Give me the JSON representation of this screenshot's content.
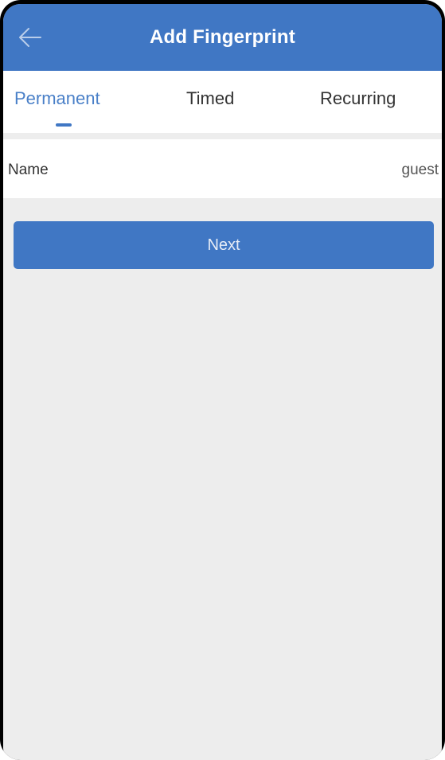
{
  "header": {
    "title": "Add Fingerprint",
    "back_icon": "arrow-left-icon",
    "background_color": "#4077c4"
  },
  "tabs": [
    {
      "label": "Permanent",
      "active": true
    },
    {
      "label": "Timed",
      "active": false
    },
    {
      "label": "Recurring",
      "active": false
    }
  ],
  "form": {
    "name_label": "Name",
    "name_value": "guest"
  },
  "actions": {
    "next_label": "Next"
  },
  "colors": {
    "accent": "#4077c4",
    "active_tab_text": "#4a80c8",
    "content_background": "#ededed"
  }
}
